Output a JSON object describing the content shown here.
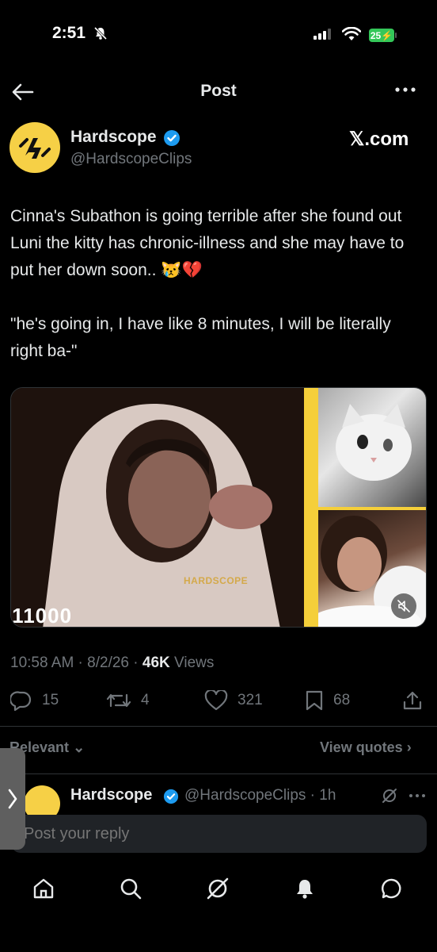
{
  "status_bar": {
    "time": "2:51",
    "battery": "25"
  },
  "header": {
    "title": "Post"
  },
  "post": {
    "author_name": "Hardscope",
    "author_handle": "@HardscopeClips",
    "source_label": "𝕏.com",
    "text_paragraphs": [
      "Cinna's Subathon is going terrible after she found out Luni the kitty has chronic-illness and she may have to put her down soon.. 😿💔",
      "\"he's going in, I have like 8 minutes, I will be literally right ba-\""
    ],
    "media": {
      "counter_text": "'11000",
      "watermark": "HARDSCOPE"
    },
    "timestamp": "10:58 AM · 8/2/26 · ",
    "views_count": "46K",
    "views_label": " Views",
    "stats": {
      "replies": "15",
      "reposts": "4",
      "likes": "321",
      "bookmarks": "68"
    }
  },
  "replies_section": {
    "sort_label": "Relevant",
    "view_quotes_label": "View quotes"
  },
  "reply_preview": {
    "author_name": "Hardscope",
    "meta": "@HardscopeClips · 1h"
  },
  "composer": {
    "placeholder": "Post your reply"
  },
  "colors": {
    "background": "#000000",
    "text": "#e7e9ea",
    "muted": "#71767b",
    "verified": "#1d9bf0",
    "brand_yellow": "#f6d046",
    "battery": "#34c759"
  }
}
